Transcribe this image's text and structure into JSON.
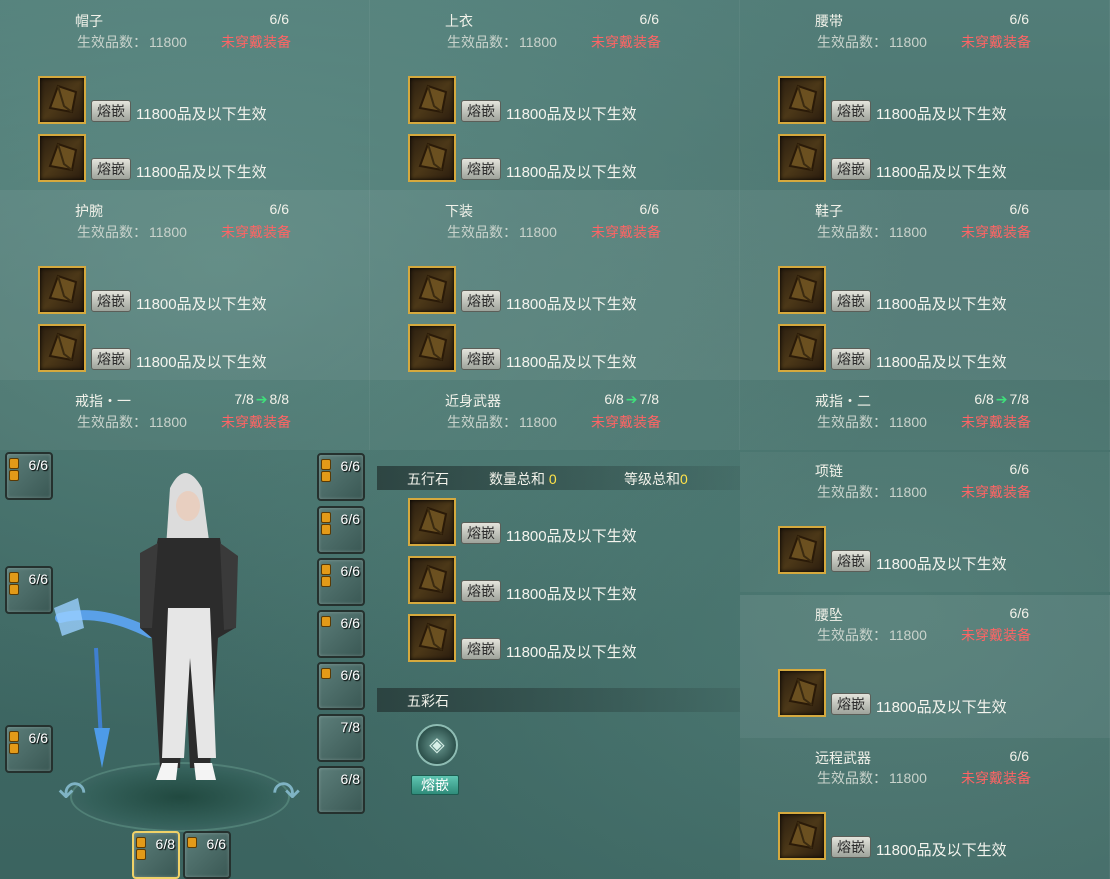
{
  "common": {
    "grade_label": "生效品数：",
    "grade_value": "11800",
    "status_unequipped": "未穿戴装备",
    "embed_button": "熔嵌",
    "embed_effect": "11800品及以下生效"
  },
  "panels": [
    {
      "name": "帽子",
      "count": "6/6"
    },
    {
      "name": "上衣",
      "count": "6/6"
    },
    {
      "name": "腰带",
      "count": "6/6"
    },
    {
      "name": "护腕",
      "count": "6/6"
    },
    {
      "name": "下装",
      "count": "6/6"
    },
    {
      "name": "鞋子",
      "count": "6/6"
    },
    {
      "name": "戒指・一",
      "count": "7/8",
      "next": "8/8"
    },
    {
      "name": "近身武器",
      "count": "6/8",
      "next": "7/8"
    },
    {
      "name": "戒指・二",
      "count": "6/8",
      "next": "7/8"
    },
    {
      "name": "项链",
      "count": "6/6"
    },
    {
      "name": "腰坠",
      "count": "6/6"
    },
    {
      "name": "远程武器",
      "count": "6/6"
    }
  ],
  "arrow_glyph": "➔",
  "five_elements": {
    "title": "五行石",
    "quantity_label": "数量总和",
    "quantity_value": "0",
    "level_label": "等级总和",
    "level_value": "0"
  },
  "five_colors": {
    "title": "五彩石",
    "button": "熔嵌",
    "slot_glyph": "◈"
  },
  "equip_slots": {
    "left": [
      "6/6",
      "6/6",
      "6/6"
    ],
    "right": [
      "6/6",
      "6/6",
      "6/6",
      "6/6",
      "6/6",
      "7/8",
      "6/8"
    ],
    "bottom": [
      "6/8",
      "6/6"
    ]
  },
  "rotate_left": "↶",
  "rotate_right": "↷"
}
